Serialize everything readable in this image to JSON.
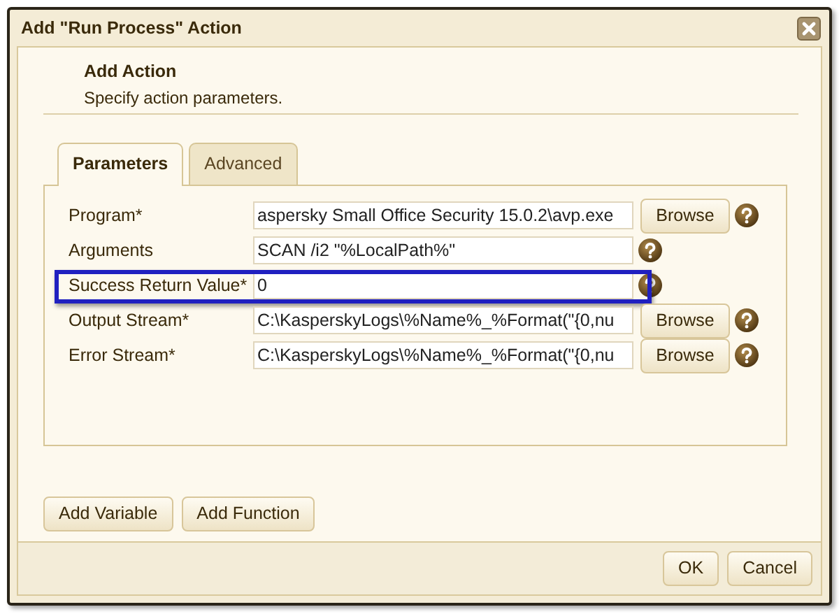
{
  "window": {
    "title": "Add \"Run Process\" Action"
  },
  "header": {
    "title": "Add Action",
    "subtitle": "Specify action parameters."
  },
  "tabs": [
    {
      "label": "Parameters",
      "selected": true
    },
    {
      "label": "Advanced",
      "selected": false
    }
  ],
  "fields": [
    {
      "kind": "browse",
      "label": "Program*",
      "value": "aspersky Small Office Security 15.0.2\\avp.exe",
      "button": "Browse",
      "highlighted": false
    },
    {
      "kind": "plain",
      "label": "Arguments",
      "value": "SCAN /i2 \"%LocalPath%\"",
      "highlighted": false
    },
    {
      "kind": "plain",
      "label": "Success Return Value*",
      "value": "0",
      "highlighted": true
    },
    {
      "kind": "browse",
      "label": "Output Stream*",
      "value": "C:\\KasperskyLogs\\%Name%_%Format(\"{0,nu",
      "button": "Browse",
      "highlighted": false
    },
    {
      "kind": "browse",
      "label": "Error Stream*",
      "value": "C:\\KasperskyLogs\\%Name%_%Format(\"{0,nu",
      "button": "Browse",
      "highlighted": false
    }
  ],
  "tool_buttons": [
    "Add Variable",
    "Add Function"
  ],
  "footer_buttons": [
    "OK",
    "Cancel"
  ]
}
